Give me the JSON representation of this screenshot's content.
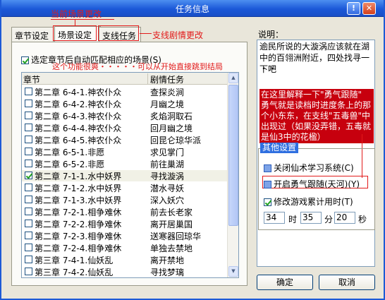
{
  "window": {
    "title": "任务信息",
    "help_glyph": "!",
    "close_glyph": "✕"
  },
  "annotations": {
    "scene_change": "当前场景更改",
    "branch_change": "支线剧情更改",
    "feature_note": "这个功能很爽・・・・・可以从开始直接跳到结局"
  },
  "tabs": [
    {
      "label": "章节设定"
    },
    {
      "label": "场景设定"
    },
    {
      "label": "支线任务"
    }
  ],
  "auto_match": {
    "label": "选定章节后自动匹配相应的场景(S)",
    "checked": true
  },
  "list": {
    "headers": {
      "chapter": "章节",
      "task": "剧情任务"
    },
    "rows": [
      {
        "chapter": "第二章  6-4-1.神农仆众",
        "task": "查探炎涧",
        "checked": false
      },
      {
        "chapter": "第二章  6-4-2.神农仆众",
        "task": "月幽之境",
        "checked": false
      },
      {
        "chapter": "第二章  6-4-3.神农仆众",
        "task": "炙焰洞取石",
        "checked": false
      },
      {
        "chapter": "第二章  6-4-4.神农仆众",
        "task": "回月幽之境",
        "checked": false
      },
      {
        "chapter": "第二章  6-4-5.神农仆众",
        "task": "回昆仑琼华派",
        "checked": false
      },
      {
        "chapter": "第二章  6-5-1.非愿",
        "task": "求见掌门",
        "checked": false
      },
      {
        "chapter": "第二章  6-5-2.非愿",
        "task": "前往巢湖",
        "checked": false
      },
      {
        "chapter": "第二章  7-1-1.水中妖界",
        "task": "寻找漩涡",
        "checked": true
      },
      {
        "chapter": "第二章  7-1-2.水中妖界",
        "task": "潜水寻妖",
        "checked": false
      },
      {
        "chapter": "第二章  7-1-3.水中妖界",
        "task": "深入妖穴",
        "checked": false
      },
      {
        "chapter": "第二章  7-2-1.相争难休",
        "task": "前去长老家",
        "checked": false
      },
      {
        "chapter": "第二章  7-2-2.相争难休",
        "task": "离开居巢国",
        "checked": false
      },
      {
        "chapter": "第二章  7-2-3.相争难休",
        "task": "送寒器回琼华",
        "checked": false
      },
      {
        "chapter": "第二章  7-2-4.相争难休",
        "task": "单独去禁地",
        "checked": false
      },
      {
        "chapter": "第三章  7-4-1.仙妖乱",
        "task": "离开禁地",
        "checked": false
      },
      {
        "chapter": "第三章  7-4-2.仙妖乱",
        "task": "寻找梦璃",
        "checked": false
      }
    ]
  },
  "description": {
    "label": "说明：",
    "text": "逾民所说的大漩涡应该就在湖中的百翎洲附近，四处找寻一下吧",
    "dots": "・・",
    "note": "在这里解释一下\"勇气跟随\" 勇气就是读档时进度条上的那个小东东，在支线\"五毒兽\"中出现过（如果没弄错，五毒就是仙3中的花楹）"
  },
  "other": {
    "title": "其他设置",
    "close_fairy": "关闭仙术学习系统(C)",
    "brave_follow": "开启勇气跟随(天河)(Y)",
    "modify_time": "修改游戏累计用时(T)",
    "modify_time_checked": true,
    "hours": "34",
    "hours_label": "时",
    "minutes": "35",
    "minutes_label": "分",
    "seconds": "20",
    "seconds_label": "秒"
  },
  "buttons": {
    "ok": "确定",
    "cancel": "取消"
  }
}
